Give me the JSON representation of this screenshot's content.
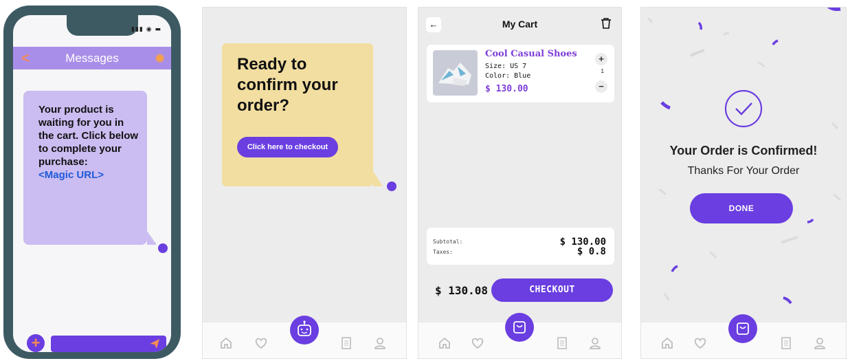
{
  "sms_screen": {
    "header_title": "Messages",
    "message_body": "Your product is waiting for you in the cart. Click below to complete your purchase:",
    "message_link": "<Magic URL>",
    "colors": {
      "frame": "#3d5a63",
      "header": "#a98ee9",
      "bubble": "#cbbcf1",
      "accent": "#6a3ee0",
      "orange": "#f58a55",
      "link": "#1f5ad9"
    },
    "icons": [
      "back-chevron-icon",
      "gear-icon",
      "signal-icon",
      "wifi-icon",
      "battery-icon",
      "plus-icon",
      "send-icon"
    ]
  },
  "bot_screen": {
    "question": "Ready to confirm your order?",
    "checkout_link_label": "Click here to checkout",
    "colors": {
      "bubble": "#f2dea0",
      "accent": "#6a3ee0"
    },
    "icons": [
      "home-icon",
      "heart-icon",
      "robot-icon",
      "document-icon",
      "user-icon"
    ]
  },
  "cart_screen": {
    "title": "My Cart",
    "item": {
      "name": "Cool Casual Shoes",
      "size": "Size: US 7",
      "color": "Color: Blue",
      "price": "$ 130.00",
      "quantity": "1"
    },
    "summary": {
      "subtotal_label": "Subtotal:",
      "subtotal_value": "$ 130.00",
      "taxes_label": "Taxes:",
      "taxes_value": "$ 0.8"
    },
    "total": "$ 130.08",
    "checkout_label": "CHECKOUT",
    "icons": [
      "back-arrow-icon",
      "trash-icon",
      "plus-icon",
      "minus-icon",
      "home-icon",
      "heart-icon",
      "bag-icon",
      "document-icon",
      "user-icon"
    ]
  },
  "confirm_screen": {
    "title": "Your Order is Confirmed!",
    "subtitle": "Thanks For Your Order",
    "done_label": "DONE",
    "icons": [
      "check-circle-icon",
      "home-icon",
      "heart-icon",
      "bag-icon",
      "document-icon",
      "user-icon"
    ]
  }
}
